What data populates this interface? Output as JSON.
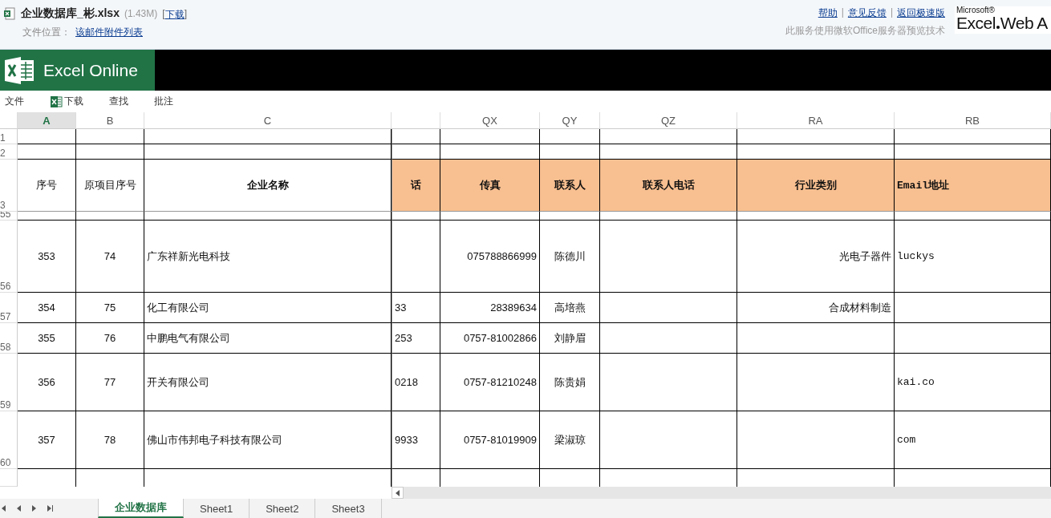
{
  "file_header": {
    "title": "企业数据库_彬.xlsx",
    "size": "(1.43M)",
    "bracket_open": "[",
    "download_link": "下载",
    "bracket_close": "]",
    "location_label": "文件位置：",
    "location_link": "该邮件附件列表",
    "links": [
      "帮助",
      "意见反馈",
      "返回极速版"
    ],
    "separator": "|",
    "note": "此服务使用微软Office服务器预览技术",
    "logo_top": "Microsoft®",
    "logo_main": "Excel",
    "logo_rest": "Web A"
  },
  "app_bar": {
    "title": "Excel Online"
  },
  "toolbar": [
    {
      "label": "文件",
      "kind": "plain"
    },
    {
      "label": "下载",
      "kind": "excel"
    },
    {
      "label": "查找",
      "kind": "plain"
    },
    {
      "label": "批注",
      "kind": "plain"
    }
  ],
  "sheet": {
    "columns": [
      {
        "letter": "A",
        "selected": true
      },
      {
        "letter": "B",
        "selected": false
      },
      {
        "letter": "C",
        "selected": false
      },
      {
        "selected": false
      },
      {
        "letter": "QX",
        "selected": false
      },
      {
        "letter": "QY",
        "selected": false
      },
      {
        "letter": "QZ",
        "selected": false
      },
      {
        "letter": "RA",
        "selected": false
      },
      {
        "letter": "RB",
        "selected": false
      }
    ],
    "rows": [
      {
        "number": "1",
        "kind": "blank",
        "cells": []
      },
      {
        "number": "2",
        "kind": "blank",
        "cells": []
      },
      {
        "number": "3",
        "kind": "header",
        "cells": [
          {
            "text": "序号",
            "shaded": false
          },
          {
            "text": "原项目序号",
            "shaded": false
          },
          {
            "text": "企业名称",
            "shaded": false
          },
          {
            "text": "话",
            "shaded": true
          },
          {
            "text": "传真",
            "shaded": true
          },
          {
            "text": "联系人",
            "shaded": true
          },
          {
            "text": "联系人电话",
            "shaded": true
          },
          {
            "text": "行业类别",
            "shaded": true
          },
          {
            "text": "Email地址",
            "shaded": true
          }
        ]
      },
      {
        "number": "55",
        "kind": "blank",
        "cells": []
      },
      {
        "number": "56",
        "kind": "data",
        "cells": [
          "353",
          "74",
          "广东祥新光电科技",
          null,
          "075788866999",
          "陈德川",
          null,
          "光电子器件",
          "luckys"
        ]
      },
      {
        "number": "57",
        "kind": "data",
        "cells": [
          "354",
          "75",
          "化工有限公司",
          "33",
          "28389634",
          "高培燕",
          null,
          "合成材料制造",
          null
        ]
      },
      {
        "number": "58",
        "kind": "data",
        "cells": [
          "355",
          "76",
          "中鹏电气有限公司",
          "253",
          "0757-81002866",
          "刘静眉",
          null,
          null,
          null
        ]
      },
      {
        "number": "59",
        "kind": "data",
        "cells": [
          "356",
          "77",
          "开关有限公司",
          "0218",
          "0757-81210248",
          "陈贵娟",
          null,
          null,
          "kai.co"
        ]
      },
      {
        "number": "60",
        "kind": "data",
        "cells": [
          "357",
          "78",
          "佛山市伟邦电子科技有限公司",
          "9933",
          "0757-81019909",
          "梁淑琼",
          null,
          null,
          "com"
        ]
      },
      {
        "number": null,
        "kind": "blank",
        "cells": []
      }
    ]
  },
  "sheet_tabs": [
    {
      "label": "企业数据库",
      "selected": true
    },
    {
      "label": "Sheet1",
      "selected": false
    },
    {
      "label": "Sheet2",
      "selected": false
    },
    {
      "label": "Sheet3",
      "selected": false
    }
  ]
}
